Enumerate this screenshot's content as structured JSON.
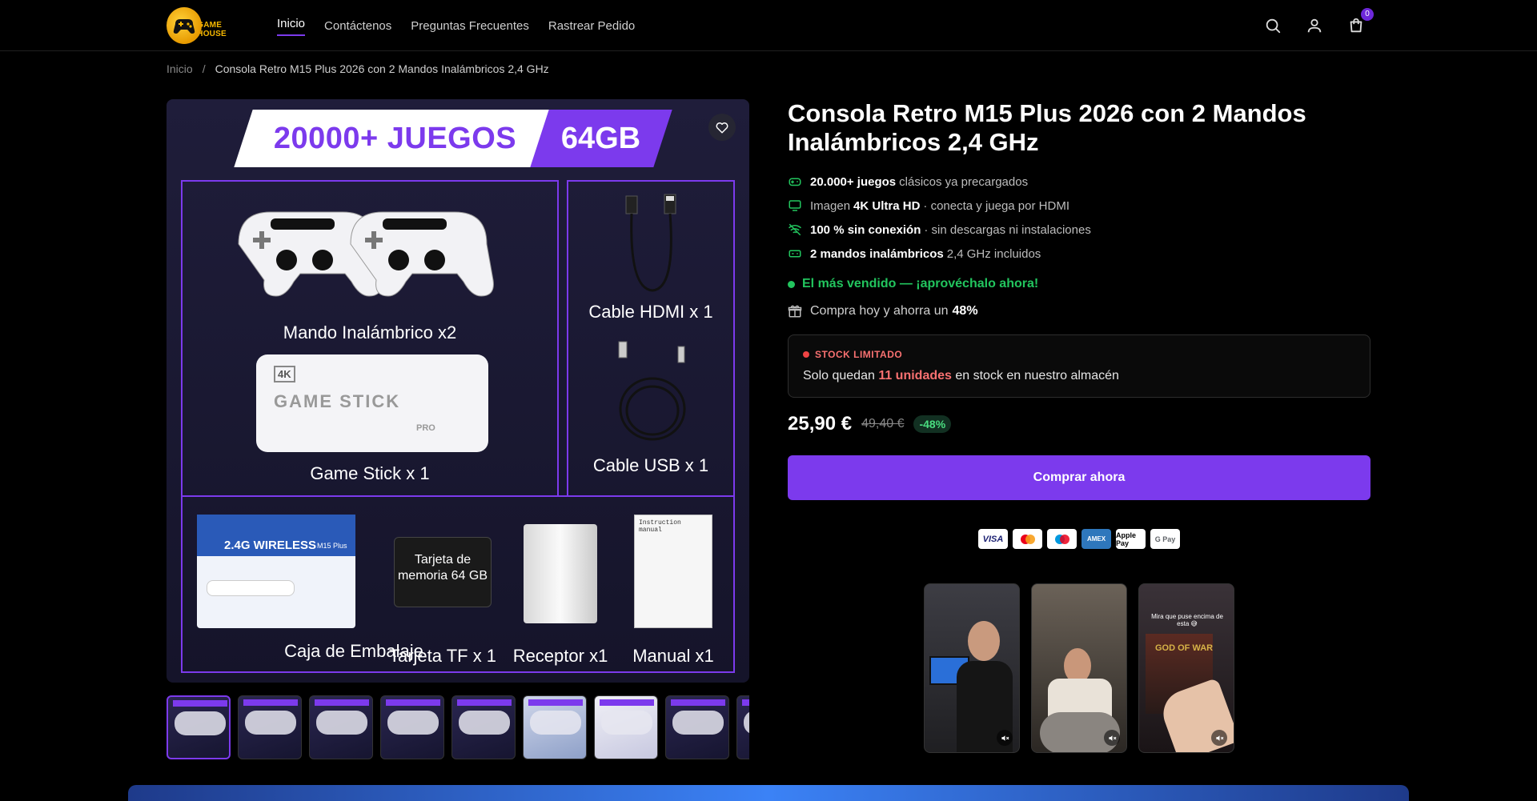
{
  "brand": {
    "logo_text": "GAME HOUSE"
  },
  "nav": [
    {
      "label": "Inicio"
    },
    {
      "label": "Contáctenos"
    },
    {
      "label": "Preguntas Frecuentes"
    },
    {
      "label": "Rastrear Pedido"
    }
  ],
  "header": {
    "cart_count": "0"
  },
  "breadcrumb": {
    "home": "Inicio",
    "separator": "/",
    "current": "Consola Retro M15 Plus 2026 con 2 Mandos Inalámbricos 2,4 GHz"
  },
  "gallery": {
    "banner_left": "20000+ JUEGOS",
    "banner_right": "64GB",
    "items": {
      "controllers": "Mando Inalámbrico x2",
      "stick": "Game Stick x 1",
      "stick_text": "GAME STICK",
      "stick_badge": "4K",
      "stick_sub": "PRO",
      "hdmi": "Cable HDMI x 1",
      "usb": "Cable USB x 1",
      "box": "Caja de Embalaje",
      "box_text": "2.4G WIRELESS",
      "box_model": "M15 Plus",
      "card": "Tarjeta TF x 1",
      "card_text": "Tarjeta de memoria 64 GB",
      "receiver": "Receptor x1",
      "manual": "Manual x1",
      "manual_text": "Instruction manual"
    }
  },
  "product": {
    "title": "Consola Retro M15 Plus 2026 con 2 Mandos Inalámbricos 2,4 GHz",
    "features": [
      {
        "bold": "20.000+ juegos",
        "pre": "",
        "text": "clásicos ya precargados",
        "icon": "gamepad-icon"
      },
      {
        "pre": "Imagen",
        "bold": "4K Ultra HD",
        "text": "· conecta y juega por HDMI",
        "icon": "monitor-icon"
      },
      {
        "bold": "100 % sin conexión",
        "pre": "",
        "text": "· sin descargas ni instalaciones",
        "icon": "wifi-off-icon"
      },
      {
        "bold": "2 mandos inalámbricos",
        "pre": "",
        "text": "2,4 GHz incluidos",
        "icon": "battery-icon"
      }
    ],
    "bestseller": "El más vendido — ¡aprovéchalo ahora!",
    "save_text": "Compra hoy y ahorra un",
    "save_pct": "48%",
    "stock_label": "STOCK LIMITADO",
    "stock_pre": "Solo quedan",
    "stock_units": "11 unidades",
    "stock_post": "en stock en nuestro almacén",
    "price": "25,90 €",
    "old_price": "49,40 €",
    "discount": "-48%",
    "buy_label": "Comprar ahora"
  },
  "payments": [
    "VISA",
    "MC",
    "MAESTRO",
    "AMEX",
    "Apple Pay",
    "G Pay"
  ],
  "videos": [
    {
      "caption": ""
    },
    {
      "caption": ""
    },
    {
      "caption": "Mira que puse encima de esta 😅",
      "game": "GOD OF WAR"
    }
  ],
  "colors": {
    "accent": "#7c3aed",
    "success": "#22c55e",
    "danger": "#ef4444"
  }
}
